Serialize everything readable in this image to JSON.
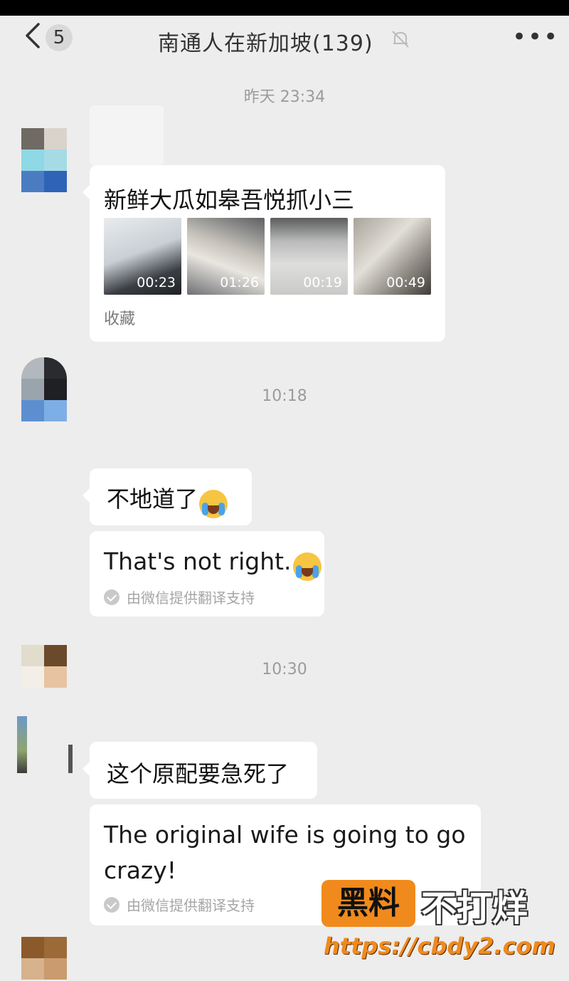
{
  "header": {
    "unread_count": "5",
    "chat_title": "南通人在新加坡(139)",
    "icons": {
      "back": "back-chevron-icon",
      "mute": "mute-bell-icon",
      "more": "more-dots-icon"
    }
  },
  "timestamps": [
    "昨天 23:34",
    "10:18",
    "10:30"
  ],
  "messages": {
    "favorite_card": {
      "title": "新鲜大瓜如皋吾悦抓小三",
      "videos": [
        {
          "duration": "00:23"
        },
        {
          "duration": "01:26"
        },
        {
          "duration": "00:19"
        },
        {
          "duration": "00:49"
        }
      ],
      "footer": "收藏"
    },
    "msg1": {
      "text": "不地道了",
      "emoji": "crying-laughing-emoji",
      "translation": "That's not right.",
      "translation_footer": "由微信提供翻译支持"
    },
    "msg2": {
      "text": "这个原配要急死了",
      "translation": "The original wife is going to go crazy!",
      "translation_footer": "由微信提供翻译支持"
    }
  },
  "watermark": {
    "badge": "黑料",
    "text": "不打烊",
    "url": "https://cbdy2.com"
  },
  "colors": {
    "background": "#ededed",
    "bubble": "#ffffff",
    "timestamp": "#9b9b9b",
    "watermark_orange": "#f08a1c"
  }
}
